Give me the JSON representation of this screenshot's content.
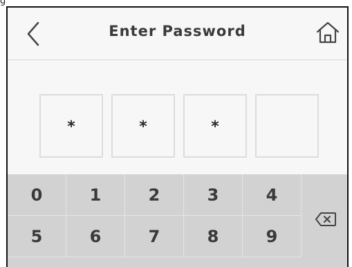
{
  "caption": "g",
  "header": {
    "title": "Enter Password",
    "back_icon": "chevron-left-icon",
    "home_icon": "home-icon"
  },
  "pin": {
    "slots": [
      "*",
      "*",
      "*",
      ""
    ]
  },
  "keypad": {
    "row1": [
      "0",
      "1",
      "2",
      "3",
      "4"
    ],
    "row2": [
      "5",
      "6",
      "7",
      "8",
      "9"
    ],
    "delete_icon": "backspace-icon"
  },
  "colors": {
    "background": "#f7f7f7",
    "keypad": "#d2d2d2",
    "text": "#3a3a3a"
  }
}
